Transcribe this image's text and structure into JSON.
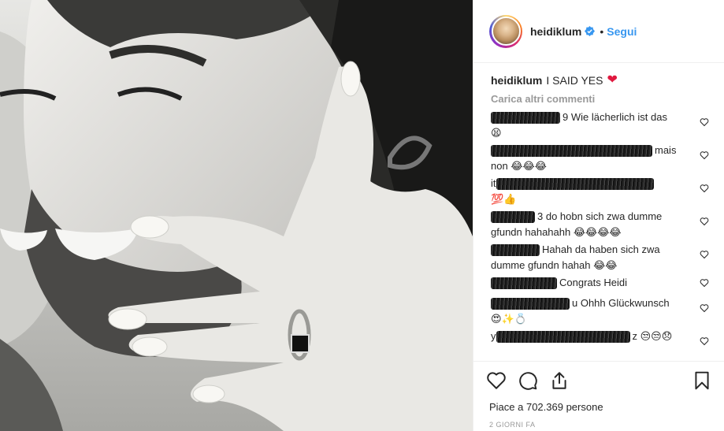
{
  "post": {
    "username": "heidiklum",
    "verified_icon": "verified-badge-icon",
    "separator": "•",
    "follow_label": "Segui"
  },
  "caption": {
    "username": "heidiklum",
    "text": "I SAID YES",
    "emoji": "❤"
  },
  "load_more": "Carica altri commenti",
  "comments": [
    {
      "visible_text": "9 Wie lächerlich ist das",
      "emoji": "😫"
    },
    {
      "visible_text": "mais non",
      "emoji": "😂😂😂"
    },
    {
      "visible_text": "it",
      "emoji": "💯👍"
    },
    {
      "visible_text": "3 do hobn sich zwa dumme gfundn hahahahh",
      "emoji": "😂😂😂😂"
    },
    {
      "visible_text": "Hahah da haben sich zwa dumme gfundn hahah",
      "emoji": "😂😂"
    },
    {
      "visible_text": "Congrats Heidi",
      "emoji": ""
    },
    {
      "visible_text": "u Ohhh Glückwunsch",
      "emoji": "😍✨💍"
    },
    {
      "visible_text_prefix": "y",
      "visible_text": "z",
      "emoji": "😒😒😞"
    }
  ],
  "actions": {
    "like_icon": "heart-outline-icon",
    "comment_icon": "comment-bubble-icon",
    "share_icon": "share-upload-icon",
    "save_icon": "bookmark-icon"
  },
  "likes_text": "Piace a 702.369 persone",
  "timestamp": "2 GIORNI FA",
  "colors": {
    "link_blue": "#3897f0",
    "heart_red": "#e0193f",
    "muted_gray": "#999999",
    "divider": "#efefef"
  }
}
